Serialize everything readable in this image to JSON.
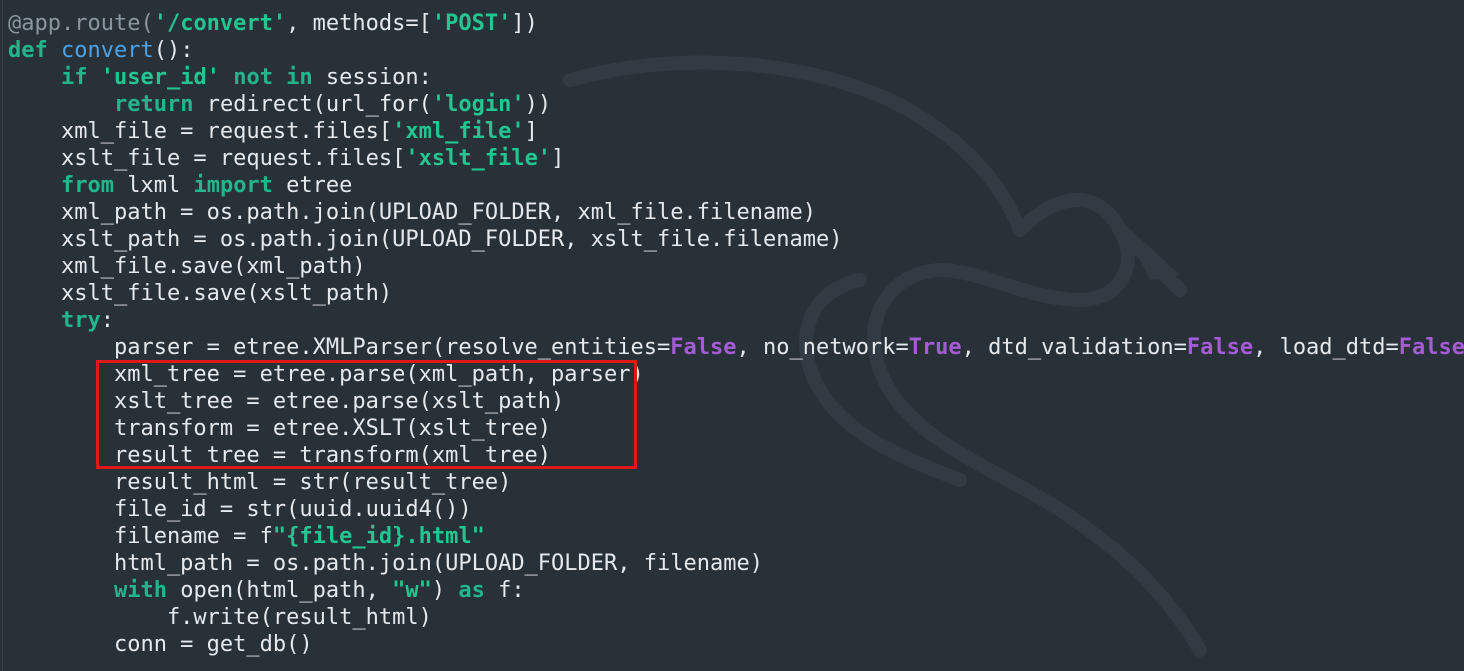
{
  "editor": {
    "background": "#283038",
    "highlight_color": "#e01818",
    "lines": [
      {
        "tokens": [
          {
            "t": "@app.route(",
            "c": "dec"
          },
          {
            "t": "'/convert'",
            "c": "str"
          },
          {
            "t": ", methods=[",
            "c": "plain"
          },
          {
            "t": "'POST'",
            "c": "str"
          },
          {
            "t": "])",
            "c": "plain"
          }
        ]
      },
      {
        "tokens": [
          {
            "t": "def",
            "c": "kw"
          },
          {
            "t": " ",
            "c": "plain"
          },
          {
            "t": "convert",
            "c": "fn"
          },
          {
            "t": "():",
            "c": "plain"
          }
        ]
      },
      {
        "tokens": [
          {
            "t": "    ",
            "c": "plain"
          },
          {
            "t": "if",
            "c": "kw"
          },
          {
            "t": " ",
            "c": "plain"
          },
          {
            "t": "'user_id'",
            "c": "str"
          },
          {
            "t": " ",
            "c": "plain"
          },
          {
            "t": "not in",
            "c": "kw"
          },
          {
            "t": " session:",
            "c": "plain"
          }
        ]
      },
      {
        "tokens": [
          {
            "t": "        ",
            "c": "plain"
          },
          {
            "t": "return",
            "c": "kw"
          },
          {
            "t": " redirect(url_for(",
            "c": "plain"
          },
          {
            "t": "'login'",
            "c": "str"
          },
          {
            "t": "))",
            "c": "plain"
          }
        ]
      },
      {
        "tokens": [
          {
            "t": "    xml_file = request.files[",
            "c": "plain"
          },
          {
            "t": "'xml_file'",
            "c": "str"
          },
          {
            "t": "]",
            "c": "plain"
          }
        ]
      },
      {
        "tokens": [
          {
            "t": "    xslt_file = request.files[",
            "c": "plain"
          },
          {
            "t": "'xslt_file'",
            "c": "str"
          },
          {
            "t": "]",
            "c": "plain"
          }
        ]
      },
      {
        "tokens": [
          {
            "t": "    ",
            "c": "plain"
          },
          {
            "t": "from",
            "c": "kw"
          },
          {
            "t": " lxml ",
            "c": "plain"
          },
          {
            "t": "import",
            "c": "kw"
          },
          {
            "t": " etree",
            "c": "plain"
          }
        ]
      },
      {
        "tokens": [
          {
            "t": "    xml_path = os.path.join(UPLOAD_FOLDER, xml_file.filename)",
            "c": "plain"
          }
        ]
      },
      {
        "tokens": [
          {
            "t": "    xslt_path = os.path.join(UPLOAD_FOLDER, xslt_file.filename)",
            "c": "plain"
          }
        ]
      },
      {
        "tokens": [
          {
            "t": "    xml_file.save(xml_path)",
            "c": "plain"
          }
        ]
      },
      {
        "tokens": [
          {
            "t": "    xslt_file.save(xslt_path)",
            "c": "plain"
          }
        ]
      },
      {
        "tokens": [
          {
            "t": "    ",
            "c": "plain"
          },
          {
            "t": "try",
            "c": "kw"
          },
          {
            "t": ":",
            "c": "plain"
          }
        ]
      },
      {
        "tokens": [
          {
            "t": "        parser = etree.XMLParser(resolve_entities=",
            "c": "plain"
          },
          {
            "t": "False",
            "c": "bool"
          },
          {
            "t": ", no_network=",
            "c": "plain"
          },
          {
            "t": "True",
            "c": "bool"
          },
          {
            "t": ", dtd_validation=",
            "c": "plain"
          },
          {
            "t": "False",
            "c": "bool"
          },
          {
            "t": ", load_dtd=",
            "c": "plain"
          },
          {
            "t": "False",
            "c": "bool"
          },
          {
            "t": ")",
            "c": "plain"
          }
        ]
      },
      {
        "tokens": [
          {
            "t": "        xml_tree = etree.parse(xml_path, parser)",
            "c": "plain"
          }
        ]
      },
      {
        "tokens": [
          {
            "t": "        xslt_tree = etree.parse(xslt_path)",
            "c": "plain"
          }
        ]
      },
      {
        "tokens": [
          {
            "t": "        transform = etree.XSLT(xslt_tree)",
            "c": "plain"
          }
        ]
      },
      {
        "tokens": [
          {
            "t": "        result_tree = transform(xml_tree)",
            "c": "plain"
          }
        ]
      },
      {
        "tokens": [
          {
            "t": "        result_html = str(result_tree)",
            "c": "plain"
          }
        ]
      },
      {
        "tokens": [
          {
            "t": "        file_id = str(uuid.uuid4())",
            "c": "plain"
          }
        ]
      },
      {
        "tokens": [
          {
            "t": "        filename = f",
            "c": "plain"
          },
          {
            "t": "\"{file_id}.html\"",
            "c": "str"
          }
        ]
      },
      {
        "tokens": [
          {
            "t": "        html_path = os.path.join(UPLOAD_FOLDER, filename)",
            "c": "plain"
          }
        ]
      },
      {
        "tokens": [
          {
            "t": "        ",
            "c": "plain"
          },
          {
            "t": "with",
            "c": "kw"
          },
          {
            "t": " open(html_path, ",
            "c": "plain"
          },
          {
            "t": "\"w\"",
            "c": "str"
          },
          {
            "t": ") ",
            "c": "plain"
          },
          {
            "t": "as",
            "c": "kw"
          },
          {
            "t": " f:",
            "c": "plain"
          }
        ]
      },
      {
        "tokens": [
          {
            "t": "            f.write(result_html)",
            "c": "plain"
          }
        ]
      },
      {
        "tokens": [
          {
            "t": "        conn = get_db()",
            "c": "plain"
          }
        ]
      }
    ]
  }
}
